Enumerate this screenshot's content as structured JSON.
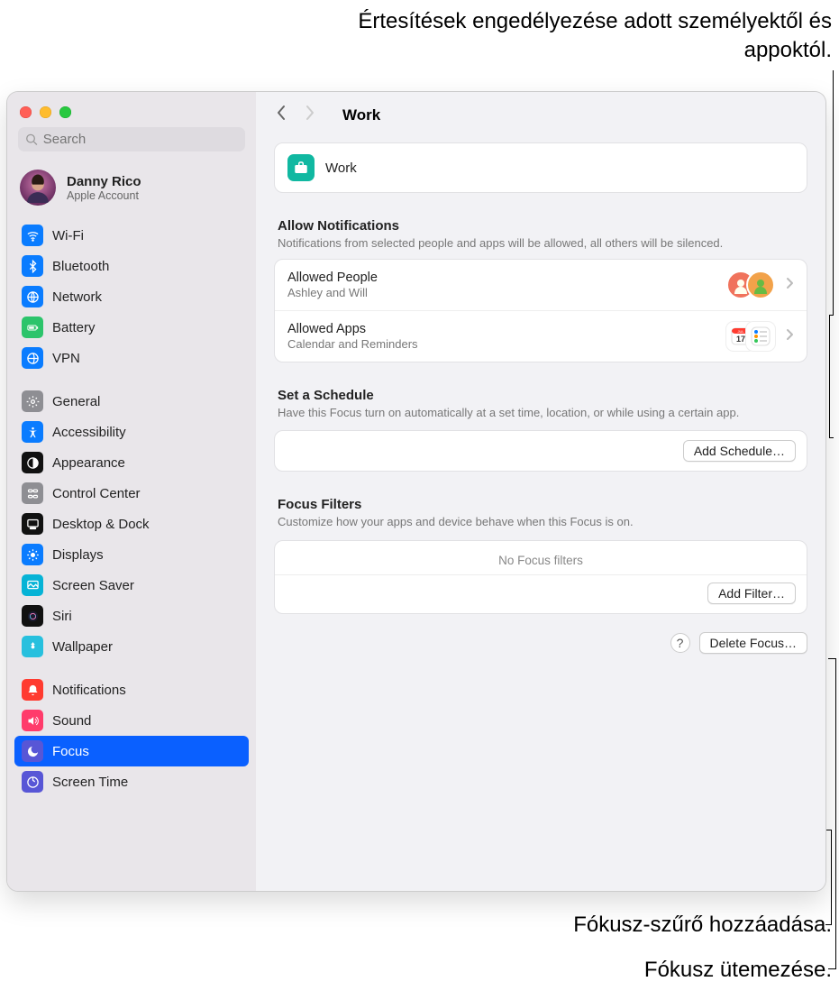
{
  "annotations": {
    "top": "Értesítések engedélyezése adott személyektől és appoktól.",
    "filter": "Fókusz-szűrő hozzáadása.",
    "schedule": "Fókusz ütemezése."
  },
  "window": {
    "search_placeholder": "Search",
    "profile": {
      "name": "Danny Rico",
      "sub": "Apple Account"
    }
  },
  "sidebar": {
    "groups": [
      {
        "items": [
          {
            "id": "wifi",
            "label": "Wi-Fi",
            "color": "#0a7cff"
          },
          {
            "id": "bluetooth",
            "label": "Bluetooth",
            "color": "#0a7cff"
          },
          {
            "id": "network",
            "label": "Network",
            "color": "#0a7cff"
          },
          {
            "id": "battery",
            "label": "Battery",
            "color": "#2cc46b"
          },
          {
            "id": "vpn",
            "label": "VPN",
            "color": "#0a7cff"
          }
        ]
      },
      {
        "items": [
          {
            "id": "general",
            "label": "General",
            "color": "#8e8e93"
          },
          {
            "id": "accessibility",
            "label": "Accessibility",
            "color": "#0a7cff"
          },
          {
            "id": "appearance",
            "label": "Appearance",
            "color": "#111"
          },
          {
            "id": "control-center",
            "label": "Control Center",
            "color": "#8e8e93"
          },
          {
            "id": "desktop-dock",
            "label": "Desktop & Dock",
            "color": "#111"
          },
          {
            "id": "displays",
            "label": "Displays",
            "color": "#0a7cff"
          },
          {
            "id": "screen-saver",
            "label": "Screen Saver",
            "color": "#06b3d6"
          },
          {
            "id": "siri",
            "label": "Siri",
            "color": "#111"
          },
          {
            "id": "wallpaper",
            "label": "Wallpaper",
            "color": "#27c0de"
          }
        ]
      },
      {
        "items": [
          {
            "id": "notifications",
            "label": "Notifications",
            "color": "#ff3b30"
          },
          {
            "id": "sound",
            "label": "Sound",
            "color": "#ff3b6b"
          },
          {
            "id": "focus",
            "label": "Focus",
            "color": "#5856d6",
            "active": true
          },
          {
            "id": "screen-time",
            "label": "Screen Time",
            "color": "#5856d6"
          }
        ]
      }
    ]
  },
  "content": {
    "title": "Work",
    "focus_name": "Work",
    "allow": {
      "h": "Allow Notifications",
      "d": "Notifications from selected people and apps will be allowed, all others will be silenced.",
      "people_t": "Allowed People",
      "people_s": "Ashley and Will",
      "apps_t": "Allowed Apps",
      "apps_s": "Calendar and Reminders"
    },
    "schedule": {
      "h": "Set a Schedule",
      "d": "Have this Focus turn on automatically at a set time, location, or while using a certain app.",
      "btn": "Add Schedule…"
    },
    "filters": {
      "h": "Focus Filters",
      "d": "Customize how your apps and device behave when this Focus is on.",
      "empty": "No Focus filters",
      "btn": "Add Filter…"
    },
    "delete_btn": "Delete Focus…",
    "help": "?"
  }
}
